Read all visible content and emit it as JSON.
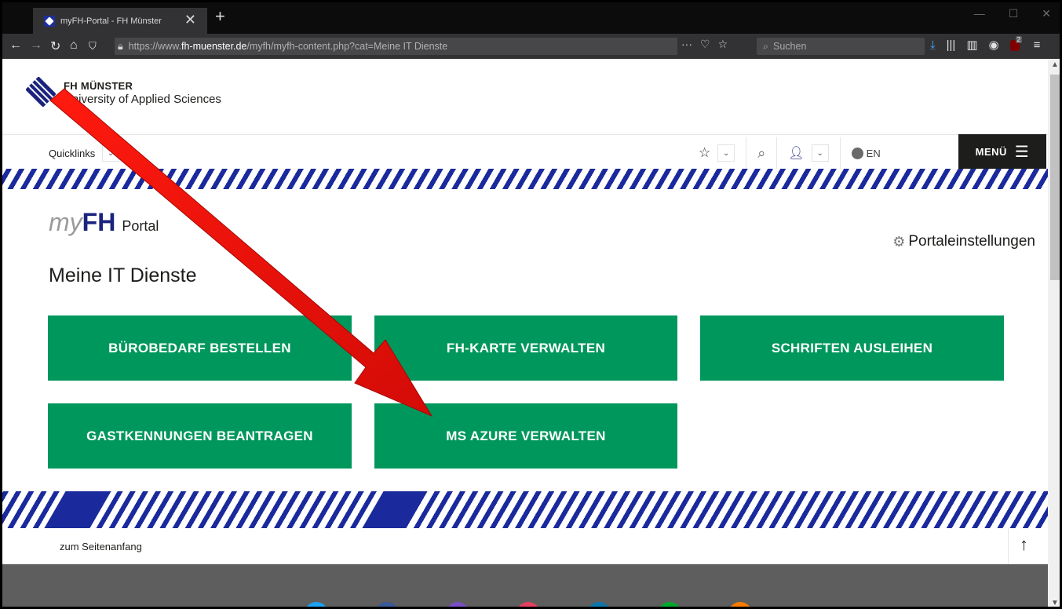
{
  "browser": {
    "tab_title": "myFH-Portal - FH Münster",
    "tab_close": "✕",
    "new_tab": "+",
    "url_prefix": "https://www.",
    "url_host": "fh-muenster.de",
    "url_rest": "/myfh/myfh-content.php?cat=Meine IT Dienste",
    "search_placeholder": "Suchen",
    "badge_count": "2",
    "icons": [
      "back-icon",
      "forward-icon",
      "reload-icon",
      "home-icon",
      "shield-icon",
      "lock-icon",
      "more-icon",
      "pocket-icon",
      "bookmark-star-icon",
      "download-icon",
      "library-icon",
      "sidebar-icon",
      "account-icon",
      "ublock-icon",
      "hamburger-icon"
    ]
  },
  "header": {
    "org_line1": "FH MÜNSTER",
    "org_line2": "University of Applied Sciences",
    "quicklinks": "Quicklinks",
    "lang": "EN",
    "menu": "MENÜ"
  },
  "portal": {
    "brand_my": "my",
    "brand_fh": "FH",
    "brand_portal": "Portal",
    "settings": "Portaleinstellungen",
    "title": "Meine IT Dienste"
  },
  "tiles": [
    "BÜROBEDARF BESTELLEN",
    "FH-KARTE VERWALTEN",
    "SCHRIFTEN AUSLEIHEN",
    "GASTKENNUNGEN BEANTRAGEN",
    "MS AZURE VERWALTEN"
  ],
  "footer": {
    "to_top": "zum Seitenanfang"
  },
  "colors": {
    "tile_green": "#00975c",
    "brand_blue": "#1a237e",
    "stripe_blue": "#1a2a9c",
    "annotation_red": "#e8100c"
  }
}
